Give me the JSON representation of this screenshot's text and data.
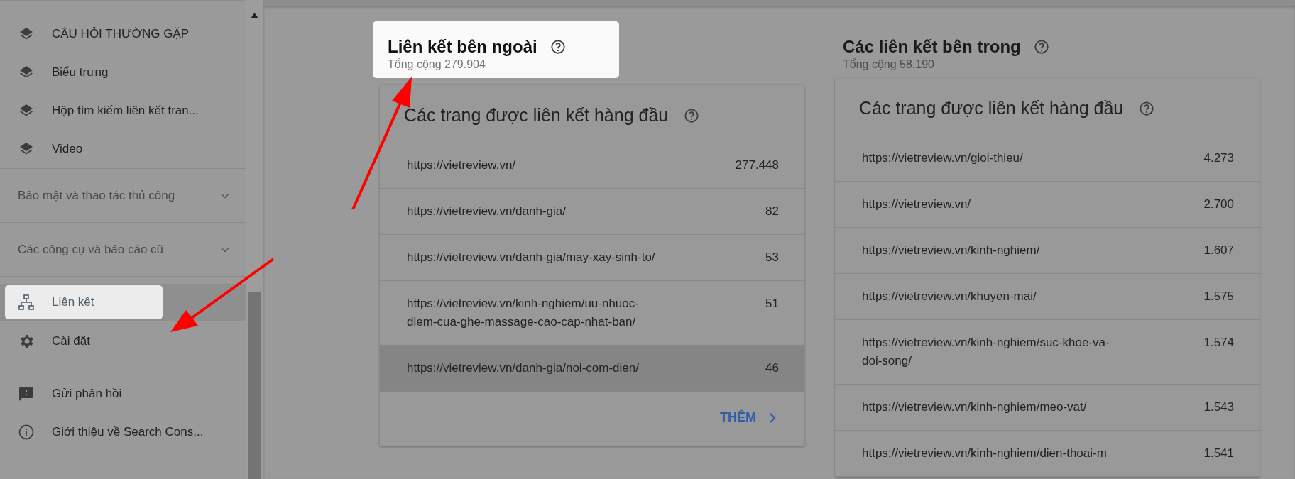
{
  "sidebar": {
    "items": [
      {
        "kind": "layers",
        "label": "CÂU HỎI THƯỜNG GẶP",
        "selected": false
      },
      {
        "kind": "layers",
        "label": "Biểu trưng",
        "selected": false
      },
      {
        "kind": "layers",
        "label": "Hộp tìm kiếm liên kết tran...",
        "selected": false
      },
      {
        "kind": "layers",
        "label": "Video",
        "selected": false
      },
      {
        "kind": "group",
        "label": "Bảo mật và thao tác thủ công",
        "expanded": false
      },
      {
        "kind": "group",
        "label": "Các công cụ và báo cáo cũ",
        "expanded": false
      },
      {
        "kind": "links",
        "label": "Liên kết",
        "selected": true
      },
      {
        "kind": "settings",
        "label": "Cài đặt",
        "selected": false
      },
      {
        "kind": "feedback",
        "label": "Gửi phản hồi",
        "selected": false
      },
      {
        "kind": "info",
        "label": "Giới thiệu về Search Cons...",
        "selected": false
      }
    ]
  },
  "sections": [
    {
      "title": "Liên kết bên ngoài",
      "total": "Tổng cộng 279.904",
      "highlighted": true,
      "card": {
        "title": "Các trang được liên kết hàng đầu",
        "more": "THÊM",
        "rows": [
          {
            "url": "https://vietreview.vn/",
            "count": "277.448",
            "hovered": false
          },
          {
            "url": "https://vietreview.vn/danh-gia/",
            "count": "82",
            "hovered": false
          },
          {
            "url": "https://vietreview.vn/danh-gia/may-xay-sinh-to/",
            "count": "53",
            "hovered": false
          },
          {
            "url": "https://vietreview.vn/kinh-nghiem/uu-nhuoc-diem-cua-ghe-massage-cao-cap-nhat-ban/",
            "count": "51",
            "hovered": false
          },
          {
            "url": "https://vietreview.vn/danh-gia/noi-com-dien/",
            "count": "46",
            "hovered": true
          }
        ]
      }
    },
    {
      "title": "Các liên kết bên trong",
      "total": "Tổng cộng 58.190",
      "highlighted": false,
      "card": {
        "title": "Các trang được liên kết hàng đầu",
        "rows": [
          {
            "url": "https://vietreview.vn/gioi-thieu/",
            "count": "4.273",
            "hovered": false
          },
          {
            "url": "https://vietreview.vn/",
            "count": "2.700",
            "hovered": false
          },
          {
            "url": "https://vietreview.vn/kinh-nghiem/",
            "count": "1.607",
            "hovered": false
          },
          {
            "url": "https://vietreview.vn/khuyen-mai/",
            "count": "1.575",
            "hovered": false
          },
          {
            "url": "https://vietreview.vn/kinh-nghiem/suc-khoe-va-doi-song/",
            "count": "1.574",
            "hovered": false
          },
          {
            "url": "https://vietreview.vn/kinh-nghiem/meo-vat/",
            "count": "1.543",
            "hovered": false
          },
          {
            "url": "https://vietreview.vn/kinh-nghiem/dien-thoai-m",
            "count": "1.541",
            "hovered": false
          }
        ]
      }
    }
  ]
}
